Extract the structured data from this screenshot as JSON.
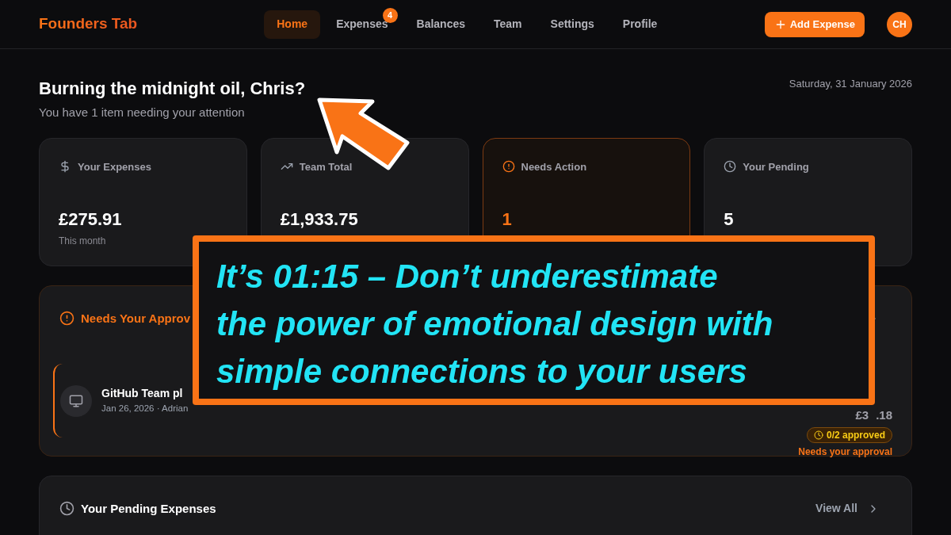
{
  "nav": {
    "brand": "Founders Tab",
    "items": [
      {
        "label": "Home",
        "selected": true
      },
      {
        "label": "Expenses",
        "selected": false,
        "badge": "4"
      },
      {
        "label": "Balances",
        "selected": false
      },
      {
        "label": "Team",
        "selected": false
      },
      {
        "label": "Settings",
        "selected": false
      },
      {
        "label": "Profile",
        "selected": false
      }
    ],
    "add_button": "Add Expense",
    "avatar": "CH"
  },
  "greeting": {
    "title": "Burning the midnight oil, Chris?",
    "subtitle": "You have 1 item needing your attention",
    "date": "Saturday, 31 January 2026"
  },
  "stats": [
    {
      "kind": "dollar",
      "label": "Your Expenses",
      "value": "£275.91",
      "note": "This month",
      "highlight": false
    },
    {
      "kind": "trend",
      "label": "Team Total",
      "value": "£1,933.75",
      "highlight": false
    },
    {
      "kind": "alert",
      "label": "Needs Action",
      "value": "1",
      "highlight": true
    },
    {
      "kind": "clock",
      "label": "Your Pending",
      "value": "5",
      "highlight": false
    }
  ],
  "approvals": {
    "title": "Needs Your Approv",
    "items": [
      {
        "title": "GitHub Team pl",
        "meta": "Jan 26, 2026 · Adrian",
        "amount_parts": [
          "£3",
          ".18"
        ],
        "status": "0/2 approved",
        "note": "Needs your approval"
      }
    ]
  },
  "pending": {
    "title": "Your Pending Expenses",
    "view_all": "View All"
  },
  "overlay": {
    "caption_lines": [
      "It’s 01:15 – Don’t underestimate",
      "the power of emotional design with",
      "simple connections to your users"
    ]
  }
}
